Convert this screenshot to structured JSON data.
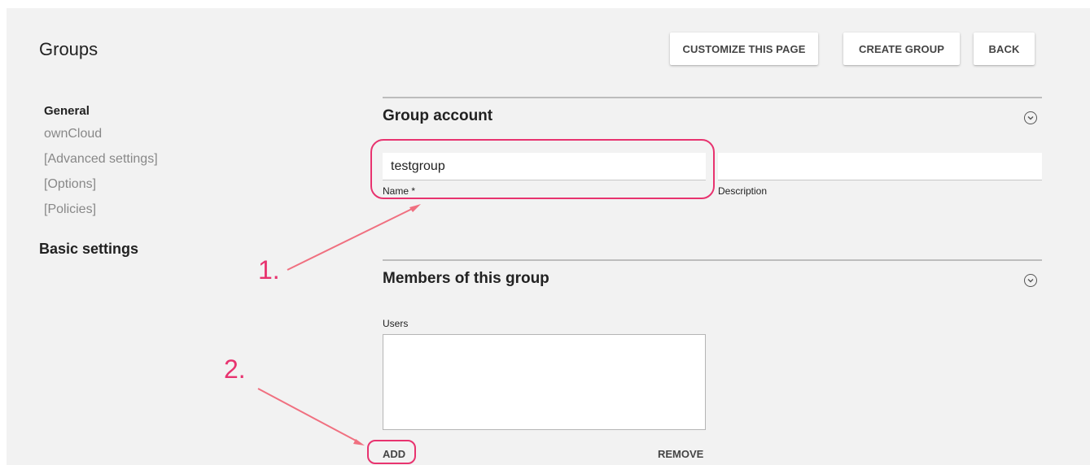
{
  "header": {
    "title": "Groups",
    "buttons": {
      "customize": "CUSTOMIZE THIS PAGE",
      "create": "CREATE GROUP",
      "back": "BACK"
    }
  },
  "sidebar": {
    "items": [
      {
        "label": "General",
        "active": true
      },
      {
        "label": "ownCloud",
        "active": false
      },
      {
        "label": "[Advanced settings]",
        "active": false
      },
      {
        "label": "[Options]",
        "active": false
      },
      {
        "label": "[Policies]",
        "active": false
      }
    ],
    "section": "Basic settings"
  },
  "group_account": {
    "title": "Group account",
    "name_value": "testgroup",
    "name_label": "Name *",
    "description_value": "",
    "description_label": "Description"
  },
  "members": {
    "title": "Members of this group",
    "users_label": "Users",
    "add_label": "ADD",
    "remove_label": "REMOVE"
  },
  "annotations": {
    "step1": "1.",
    "step2": "2.",
    "color": "#e8336f"
  },
  "icons": {
    "section_toggle": "chevron-down-circle-icon"
  }
}
